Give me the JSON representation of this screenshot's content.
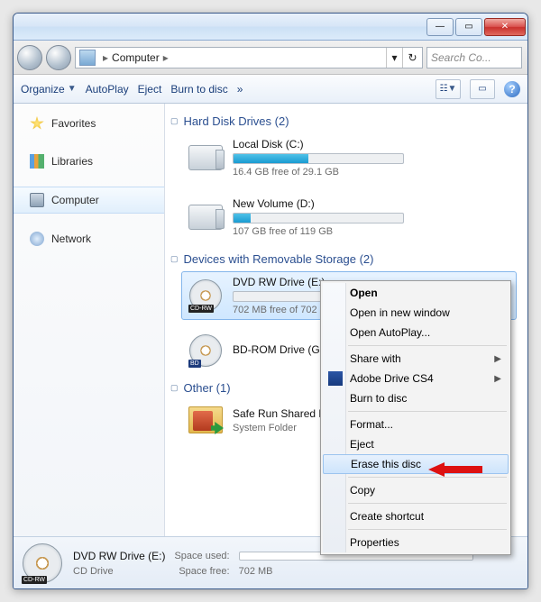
{
  "titlebar": {
    "minimize_tip": "Minimize",
    "maximize_tip": "Maximize",
    "close_tip": "Close"
  },
  "nav": {
    "location": "Computer",
    "search_placeholder": "Search Co..."
  },
  "toolbar": {
    "organize": "Organize",
    "autoplay": "AutoPlay",
    "eject": "Eject",
    "burn": "Burn to disc",
    "overflow": "»"
  },
  "sidebar": {
    "items": [
      {
        "label": "Favorites",
        "key": "favorites"
      },
      {
        "label": "Libraries",
        "key": "libraries"
      },
      {
        "label": "Computer",
        "key": "computer"
      },
      {
        "label": "Network",
        "key": "network"
      }
    ]
  },
  "groups": {
    "hdd": {
      "title": "Hard Disk Drives (2)"
    },
    "remov": {
      "title": "Devices with Removable Storage (2)"
    },
    "other": {
      "title": "Other (1)"
    }
  },
  "drives": {
    "c": {
      "name": "Local Disk (C:)",
      "free": "16.4 GB free of 29.1 GB",
      "pct": 44
    },
    "d": {
      "name": "New Volume (D:)",
      "free": "107 GB free of 119 GB",
      "pct": 10
    },
    "e": {
      "name": "DVD RW Drive (E:)",
      "free": "702 MB free of 702",
      "pct": 0,
      "badge": "CD-RW"
    },
    "g": {
      "name": "BD-ROM Drive (G:)",
      "badge": "BD"
    },
    "run": {
      "name": "Safe Run Shared Fo",
      "sub": "System Folder"
    }
  },
  "context_menu": [
    {
      "label": "Open",
      "bold": true
    },
    {
      "label": "Open in new window"
    },
    {
      "label": "Open AutoPlay..."
    },
    {
      "sep": true
    },
    {
      "label": "Share with",
      "submenu": true
    },
    {
      "label": "Adobe Drive CS4",
      "submenu": true,
      "icon": "adobe"
    },
    {
      "label": "Burn to disc"
    },
    {
      "sep": true
    },
    {
      "label": "Format..."
    },
    {
      "label": "Eject"
    },
    {
      "label": "Erase this disc",
      "highlight": true
    },
    {
      "sep": true
    },
    {
      "label": "Copy"
    },
    {
      "sep": true
    },
    {
      "label": "Create shortcut"
    },
    {
      "sep": true
    },
    {
      "label": "Properties"
    }
  ],
  "status": {
    "title": "DVD RW Drive (E:)",
    "sub": "CD Drive",
    "used_label": "Space used:",
    "free_label": "Space free:",
    "free_value": "702 MB"
  }
}
